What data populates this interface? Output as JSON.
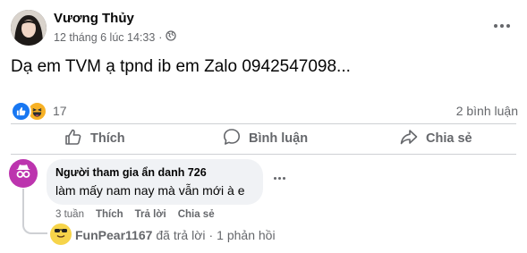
{
  "post": {
    "author": "Vương Thủy",
    "timestamp": "12 tháng 6 lúc 14:33",
    "separator": "·",
    "privacy_icon": "globe-icon",
    "text": "Dạ em TVM ạ tpnd ib em Zalo 0942547098..."
  },
  "stats": {
    "reaction_count": "17",
    "reaction_icons": [
      "like-icon",
      "haha-icon"
    ],
    "comment_count": "2 bình luận"
  },
  "actions": {
    "like_label": "Thích",
    "comment_label": "Bình luận",
    "share_label": "Chia sẻ"
  },
  "comment": {
    "author": "Người tham gia ẩn danh 726",
    "text": "làm mấy nam nay mà vẫn mới à e",
    "time": "3 tuần",
    "like_label": "Thích",
    "reply_label": "Trả lời",
    "share_label": "Chia sẻ"
  },
  "reply": {
    "author": "FunPear1167",
    "action": "đã trả lời",
    "separator": "·",
    "count": "1 phản hồi"
  },
  "colors": {
    "accent": "#1877f2",
    "secondary_text": "#65676b",
    "bubble_bg": "#f0f2f5",
    "anon_avatar": "#bc34ae",
    "divider": "#ced0d4"
  }
}
